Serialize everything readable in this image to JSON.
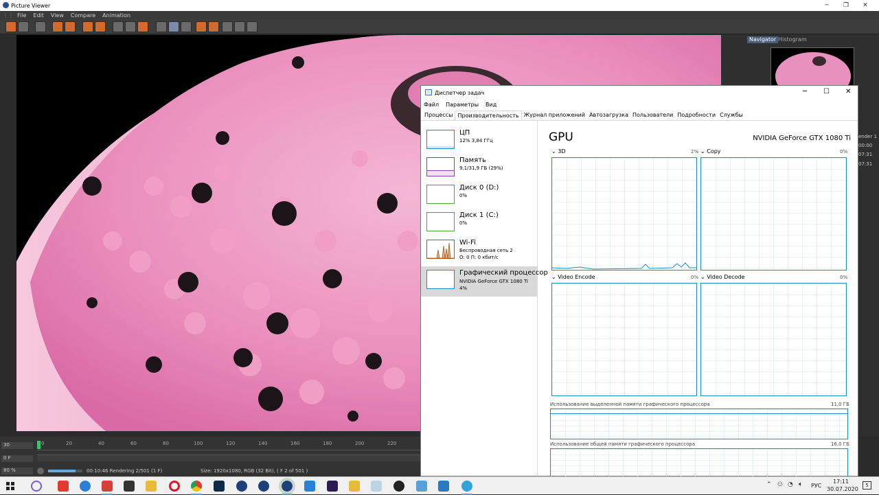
{
  "viewer": {
    "title": "Picture Viewer",
    "menu": [
      "File",
      "Edit",
      "View",
      "Compare",
      "Animation"
    ],
    "side_tabs": [
      "Navigator",
      "Histogram"
    ],
    "side_fragments": [
      "ender 1",
      "00:00",
      "07:31",
      "07:31"
    ],
    "timeline": {
      "start_field": "30",
      "frame_field": "0 F",
      "zoom": "80 %",
      "ticks": [
        "0",
        "20",
        "40",
        "60",
        "80",
        "100",
        "120",
        "140",
        "160",
        "180",
        "200",
        "220"
      ],
      "status": "00:10:46 Rendering 2/501 (1 F)",
      "size_info": "Size: 1920x1080, RGB (32 Bit),  ( F 2 of 501 )"
    }
  },
  "taskmgr": {
    "title": "Диспетчер задач",
    "menu": [
      "Файл",
      "Параметры",
      "Вид"
    ],
    "tabs": [
      "Процессы",
      "Производительность",
      "Журнал приложений",
      "Автозагрузка",
      "Пользователи",
      "Подробности",
      "Службы"
    ],
    "active_tab": 1,
    "resources": [
      {
        "name": "ЦП",
        "sub1": "12% 3,84 ГГц",
        "sub2": "",
        "color": "#1a8fc1"
      },
      {
        "name": "Память",
        "sub1": "9,1/31,9 ГБ (29%)",
        "sub2": "",
        "color": "#8b3fb0"
      },
      {
        "name": "Диск 0 (D:)",
        "sub1": "0%",
        "sub2": "",
        "color": "#4da630"
      },
      {
        "name": "Диск 1 (C:)",
        "sub1": "0%",
        "sub2": "",
        "color": "#4da630"
      },
      {
        "name": "Wi-Fi",
        "sub1": "Беспроводная сеть 2",
        "sub2": "О: 0 П: 0 кбит/с",
        "color": "#a7581a"
      },
      {
        "name": "Графический процессор",
        "sub1": "NVIDIA GeForce GTX 1080 Ti",
        "sub2": "4%",
        "color": "#1a8fc1"
      }
    ],
    "gpu": {
      "title": "GPU",
      "model": "NVIDIA GeForce GTX 1080 Ti",
      "graphs": [
        {
          "label": "3D",
          "pct": "2%"
        },
        {
          "label": "Copy",
          "pct": "0%"
        },
        {
          "label": "Video Encode",
          "pct": "0%"
        },
        {
          "label": "Video Decode",
          "pct": "0%"
        }
      ],
      "dedicated_label": "Использование выделенной памяти графического процессора",
      "dedicated_value": "11,0 ГБ",
      "shared_label": "Использование общей памяти графического процессора",
      "shared_value": "16,0 ГБ"
    }
  },
  "taskbar": {
    "lang": "РУС",
    "time": "17:11",
    "date": "30.07.2020",
    "notif": "5"
  }
}
